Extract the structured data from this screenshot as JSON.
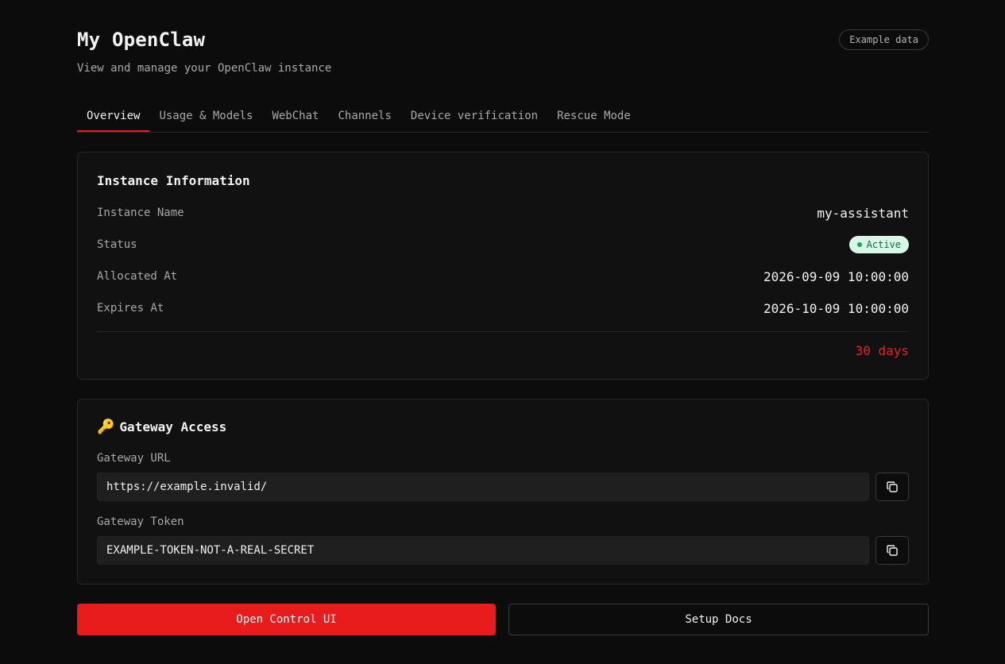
{
  "header": {
    "title": "My OpenClaw",
    "subtitle": "View and manage your OpenClaw instance",
    "badge": "Example data"
  },
  "tabs": [
    {
      "label": "Overview",
      "active": true
    },
    {
      "label": "Usage & Models",
      "active": false
    },
    {
      "label": "WebChat",
      "active": false
    },
    {
      "label": "Channels",
      "active": false
    },
    {
      "label": "Device verification",
      "active": false
    },
    {
      "label": "Rescue Mode",
      "active": false
    }
  ],
  "instance": {
    "title": "Instance Information",
    "name_label": "Instance Name",
    "name_value": "my-assistant",
    "status_label": "Status",
    "status_value": "Active",
    "allocated_label": "Allocated At",
    "allocated_value": "2026-09-09 10:00:00",
    "expires_label": "Expires At",
    "expires_value": "2026-10-09 10:00:00",
    "remaining": "30 days"
  },
  "gateway": {
    "icon": "key-icon",
    "title": "Gateway Access",
    "url_label": "Gateway URL",
    "url_value": "https://example.invalid/",
    "token_label": "Gateway Token",
    "token_value": "EXAMPLE-TOKEN-NOT-A-REAL-SECRET"
  },
  "actions": {
    "primary": "Open Control UI",
    "secondary": "Setup Docs"
  },
  "colors": {
    "accent": "#e81c1c",
    "background": "#0c0c0c",
    "status_active_bg": "#d8f8e6",
    "status_active_fg": "#0f6b3a"
  }
}
